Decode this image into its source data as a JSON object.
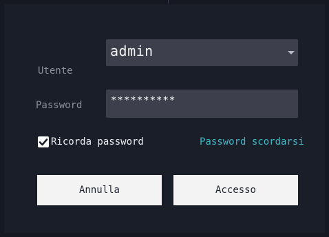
{
  "login": {
    "username_label": "Utente",
    "username_value": "admin",
    "password_label": "Password",
    "password_value": "**********",
    "remember_label": "Ricorda password",
    "remember_checked": true,
    "forgot_label": "Password scordarsi",
    "cancel_label": "Annulla",
    "login_label": "Accesso"
  },
  "colors": {
    "background": "#1a1e29",
    "field": "#3d404c",
    "link": "#3db7c5",
    "button": "#f3f3f3"
  }
}
